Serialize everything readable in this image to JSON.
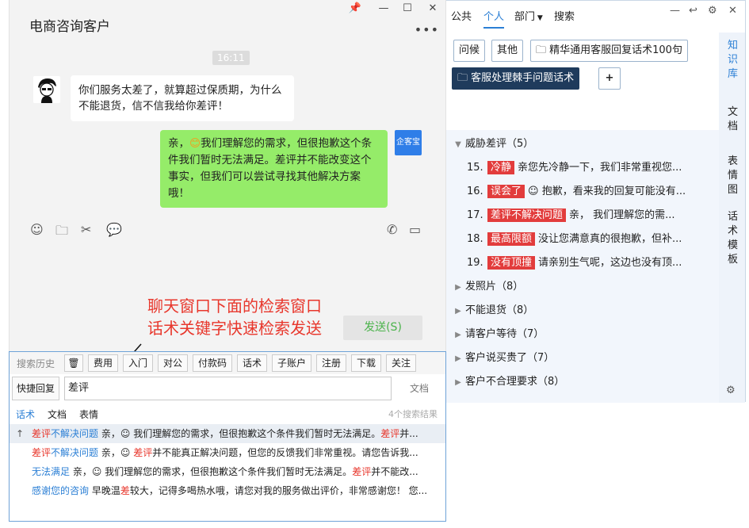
{
  "chat": {
    "title": "电商咨询客户",
    "time": "16:11",
    "customer_message": "你们服务太差了，就算超过保质期，为什么不能退货，信不信我给你差评！",
    "agent_message_before_emoji": "亲，",
    "agent_message_after_emoji": "我们理解您的需求，但很抱歉这个条件我们暂时无法满足。差评并不能改变这个事实，但我们可以尝试寻找其他解决方案哦！",
    "agent_badge": "企客宝",
    "send_button": "发送(S)",
    "annotation_line1": "聊天窗口下面的检索窗口",
    "annotation_line2": "话术关键字快速检索发送"
  },
  "search": {
    "history_label": "搜索历史",
    "chips": [
      "费用",
      "入门",
      "对公",
      "付款码",
      "话术",
      "子账户",
      "注册",
      "下载",
      "关注"
    ],
    "quick_reply": "快捷回复",
    "input_value": "差评",
    "doc_button": "文档",
    "tabs": [
      "话术",
      "文档",
      "表情"
    ],
    "result_count": "4个搜索结果",
    "results": [
      {
        "tag_pre": "",
        "tag_hl": "差评",
        "tag_post": "不解决问题",
        "text_a": " 亲，",
        "text_b": " 我们理解您的需求，但很抱歉这个条件我们暂时无法满足。",
        "hl2": "差评",
        "text_c": "并..."
      },
      {
        "tag_pre": "",
        "tag_hl": "差评",
        "tag_post": "不解决问题",
        "text_a": " 亲，",
        "text_b": " ",
        "hl2": "差评",
        "text_c": "并不能真正解决问题，但您的反馈我们非常重视。请您告诉我..."
      },
      {
        "tag_pre": "无法满足",
        "tag_hl": "",
        "tag_post": "",
        "text_a": " 亲，",
        "text_b": " 我们理解您的需求，但很抱歉这个条件我们暂时无法满足。",
        "hl2": "差评",
        "text_c": "并不能改..."
      },
      {
        "tag_pre": "感谢您的咨询",
        "tag_hl": "",
        "tag_post": "",
        "text_a": " 早晚温",
        "text_b": "",
        "hl2": "差",
        "text_c": "较大，记得多喝热水哦，请您对我的服务做出评价，非常感谢您！ 您..."
      }
    ]
  },
  "right": {
    "tabs": [
      "公共",
      "个人",
      "部门",
      "搜索"
    ],
    "buttons": [
      "问候",
      "其他",
      "精华通用客服回复话术100句",
      "客服处理棘手问题话术",
      "+"
    ],
    "vertical_tabs": [
      "知识库",
      "文档",
      "表情图",
      "话术模板"
    ],
    "open_category": "威胁差评（5）",
    "items": [
      {
        "num": "15.",
        "tag": "冷静",
        "text": "亲您先冷静一下，我们非常重视您..."
      },
      {
        "num": "16.",
        "tag": "误会了",
        "text": " 抱歉，看来我的回复可能没有..."
      },
      {
        "num": "17.",
        "tag": "差评不解决问题",
        "text": "亲， 我们理解您的需..."
      },
      {
        "num": "18.",
        "tag": "最高限额",
        "text": "没让您满意真的很抱歉，但补..."
      },
      {
        "num": "19.",
        "tag": "没有顶撞",
        "text": "请亲别生气呢，这边也没有顶..."
      }
    ],
    "categories": [
      "发照片（8）",
      "不能退货（8）",
      "请客户等待（7）",
      "客户说买贵了（7）",
      "客户不合理要求（8）"
    ]
  }
}
